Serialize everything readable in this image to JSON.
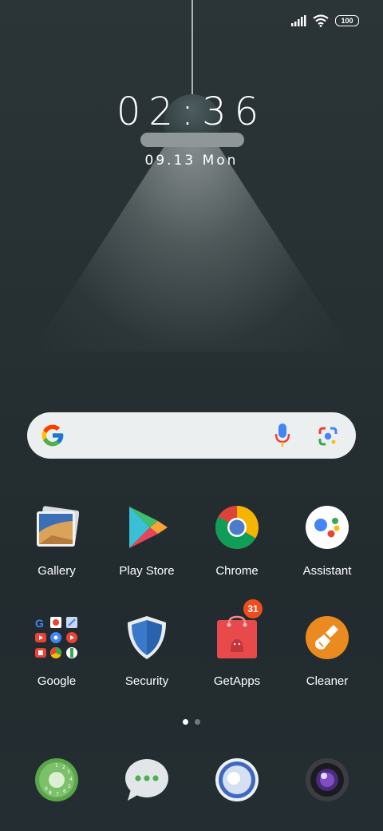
{
  "status_bar": {
    "battery": "100",
    "signal_icon": "signal-icon",
    "wifi_icon": "wifi-icon"
  },
  "clock": {
    "time": "02:36",
    "date": "09.13 Mon"
  },
  "search": {
    "logo": "google-g-icon",
    "mic": "microphone-icon",
    "lens": "google-lens-icon"
  },
  "apps_row1": [
    {
      "label": "Gallery",
      "icon": "gallery-icon"
    },
    {
      "label": "Play Store",
      "icon": "play-store-icon"
    },
    {
      "label": "Chrome",
      "icon": "chrome-icon"
    },
    {
      "label": "Assistant",
      "icon": "assistant-icon"
    }
  ],
  "apps_row2": [
    {
      "label": "Google",
      "icon": "google-folder-icon"
    },
    {
      "label": "Security",
      "icon": "security-icon"
    },
    {
      "label": "GetApps",
      "icon": "getapps-icon",
      "badge": "31"
    },
    {
      "label": "Cleaner",
      "icon": "cleaner-icon"
    }
  ],
  "dock": [
    {
      "icon": "phone-dialer-icon"
    },
    {
      "icon": "messages-icon"
    },
    {
      "icon": "browser-icon"
    },
    {
      "icon": "camera-icon"
    }
  ],
  "page_indicator": {
    "pages": 2,
    "current": 1
  }
}
